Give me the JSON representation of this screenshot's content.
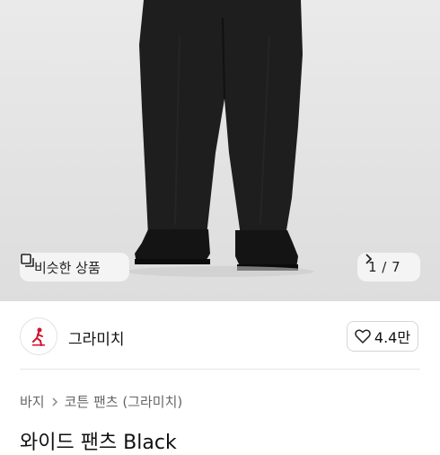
{
  "hero": {
    "similar_label": "비슷한 상품",
    "counter_label": "1 / 7",
    "background_color": "#e4e4e4"
  },
  "store": {
    "name": "그라미치",
    "like_count": "4.4만",
    "logo_color": "#d0112b"
  },
  "breadcrumb": {
    "items": [
      "바지",
      "코튼 팬츠 (그라미치)"
    ]
  },
  "product": {
    "title": "와이드 팬츠 Black"
  },
  "icons": {
    "similar": "similar-items-icon",
    "next": "chevron-right-icon",
    "like": "heart-icon",
    "breadcrumb_sep": "chevron-right-icon"
  }
}
